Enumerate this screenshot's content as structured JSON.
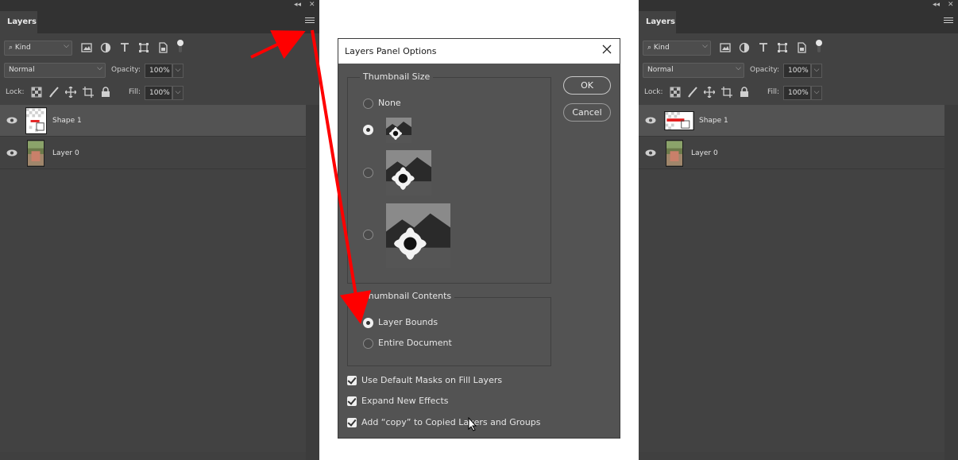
{
  "left_panel": {
    "tab": "Layers",
    "kind_select": "Kind",
    "blend_mode": "Normal",
    "opacity_label": "Opacity:",
    "opacity_value": "100%",
    "lock_label": "Lock:",
    "fill_label": "Fill:",
    "fill_value": "100%",
    "layers": [
      {
        "name": "Shape 1",
        "selected": true
      },
      {
        "name": "Layer 0",
        "selected": false
      }
    ]
  },
  "right_panel": {
    "tab": "Layers",
    "kind_select": "Kind",
    "blend_mode": "Normal",
    "opacity_label": "Opacity:",
    "opacity_value": "100%",
    "lock_label": "Lock:",
    "fill_label": "Fill:",
    "fill_value": "100%",
    "layers": [
      {
        "name": "Shape 1",
        "selected": true
      },
      {
        "name": "Layer 0",
        "selected": false
      }
    ]
  },
  "dialog": {
    "title": "Layers Panel Options",
    "thumbnail_size": {
      "legend": "Thumbnail Size",
      "options": [
        {
          "label": "None",
          "checked": false
        },
        {
          "label": "",
          "checked": true
        },
        {
          "label": "",
          "checked": false
        },
        {
          "label": "",
          "checked": false
        }
      ]
    },
    "thumbnail_contents": {
      "legend": "Thumbnail Contents",
      "options": [
        {
          "label": "Layer Bounds",
          "checked": true
        },
        {
          "label": "Entire Document",
          "checked": false
        }
      ]
    },
    "checkboxes": [
      {
        "label": "Use Default Masks on Fill Layers",
        "checked": true
      },
      {
        "label": "Expand New Effects",
        "checked": true
      },
      {
        "label": "Add “copy” to Copied Layers and Groups",
        "checked": true
      }
    ],
    "ok_label": "OK",
    "cancel_label": "Cancel"
  },
  "colors": {
    "panel_bg": "#424242",
    "selected_layer": "#535353",
    "dialog_bg": "#535353",
    "annotation_arrow": "#ff0000"
  },
  "icons": [
    "eye-icon",
    "panel-menu-icon",
    "close-icon",
    "collapse-icon",
    "lock-icon",
    "move-icon",
    "brush-icon"
  ]
}
